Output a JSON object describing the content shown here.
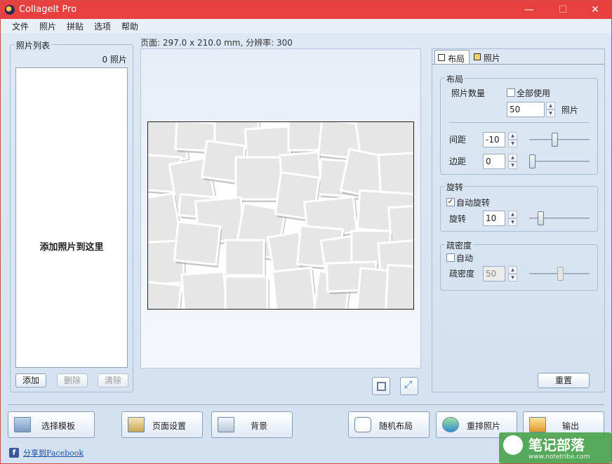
{
  "window": {
    "title": "CollageIt Pro",
    "minimize": "—",
    "maximize": "☐",
    "close": "✕"
  },
  "menu": [
    "文件",
    "照片",
    "拼贴",
    "选项",
    "帮助"
  ],
  "photo_list": {
    "title": "照片列表",
    "count": "0 照片",
    "drop_hint": "添加照片到这里",
    "add": "添加",
    "remove": "删除",
    "clear": "清除"
  },
  "page_info": "页面: 297.0 x 210.0 mm, 分辨率: 300",
  "tabs": {
    "layout": "布局",
    "photos": "照片"
  },
  "layout_group": {
    "title": "布局",
    "photo_count_label": "照片数量",
    "use_all_label": "全部使用",
    "use_all_checked": false,
    "photo_count_value": "50",
    "photo_unit": "照片",
    "spacing_label": "间距",
    "spacing_value": "-10",
    "spacing_slider": 0.4,
    "margin_label": "边距",
    "margin_value": "0",
    "margin_slider": 0.0
  },
  "rotation_group": {
    "title": "旋转",
    "auto_label": "自动旋转",
    "auto_checked": true,
    "rotate_label": "旋转",
    "rotate_value": "10",
    "rotate_slider": 0.15
  },
  "density_group": {
    "title": "疏密度",
    "auto_label": "自动",
    "auto_checked": false,
    "density_label": "疏密度",
    "density_value": "50",
    "density_slider": 0.5
  },
  "reset": "重置",
  "bottom_buttons": {
    "template": "选择模板",
    "page_setup": "页面设置",
    "background": "背景",
    "random_layout": "随机布局",
    "reorder": "重排照片",
    "export": "输出"
  },
  "share": "分享到Facebook",
  "watermark": {
    "text": "笔记部落",
    "sub": "www.notetribe.com"
  }
}
